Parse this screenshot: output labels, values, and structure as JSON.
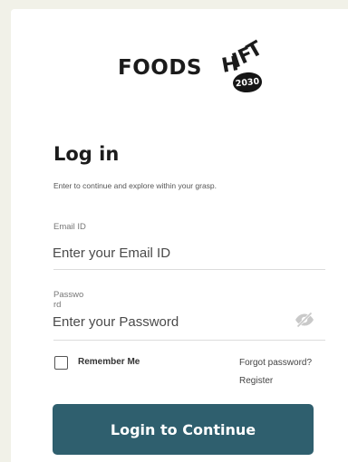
{
  "brand": {
    "name": "FOODSHIFT",
    "badge": "2030"
  },
  "login": {
    "title": "Log in",
    "subtitle": "Enter to continue and explore within your grasp.",
    "email": {
      "label": "Email ID",
      "placeholder": "Enter your Email ID",
      "value": ""
    },
    "password": {
      "label": "Password",
      "placeholder": "Enter your Password",
      "value": ""
    },
    "remember_me": {
      "label": "Remember Me",
      "checked": false
    },
    "forgot_password": "Forgot password?",
    "register": "Register",
    "submit_label": "Login to Continue"
  },
  "icons": {
    "password_toggle": "eye-slash-icon"
  },
  "colors": {
    "page_background": "#f1f1e8",
    "primary_button": "#2f5f6e",
    "button_text": "#ffffff",
    "text_dark": "#1c1c1c"
  }
}
